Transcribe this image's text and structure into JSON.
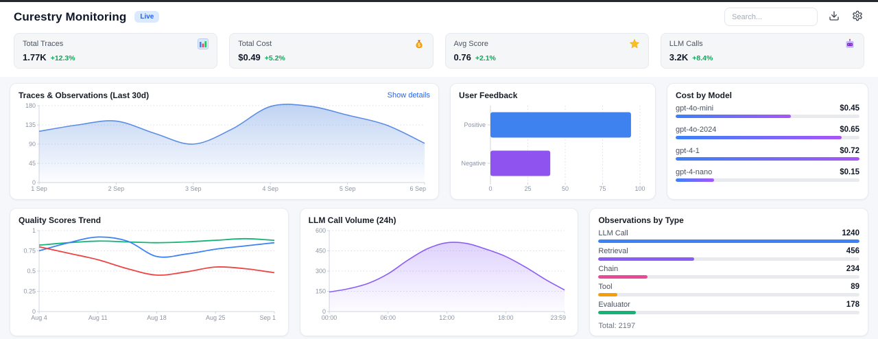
{
  "header": {
    "title": "Curestry Monitoring",
    "live_badge": "Live",
    "search_placeholder": "Search..."
  },
  "stats": [
    {
      "label": "Total Traces",
      "value": "1.77K",
      "delta": "+12.3%",
      "icon": "bar-chart"
    },
    {
      "label": "Total Cost",
      "value": "$0.49",
      "delta": "+5.2%",
      "icon": "money-bag"
    },
    {
      "label": "Avg Score",
      "value": "0.76",
      "delta": "+2.1%",
      "icon": "star"
    },
    {
      "label": "LLM Calls",
      "value": "3.2K",
      "delta": "+8.4%",
      "icon": "robot"
    }
  ],
  "panels": {
    "traces": {
      "title": "Traces & Observations (Last 30d)",
      "link": "Show details"
    },
    "feedback": {
      "title": "User Feedback"
    },
    "cost": {
      "title": "Cost by Model"
    },
    "quality": {
      "title": "Quality Scores Trend"
    },
    "volume": {
      "title": "LLM Call Volume (24h)"
    },
    "observations": {
      "title": "Observations by Type",
      "total": "Total: 2197"
    }
  },
  "chart_data": [
    {
      "id": "traces",
      "type": "area",
      "title": "Traces & Observations (Last 30d)",
      "x_ticks": [
        "1 Sep",
        "2 Sep",
        "3 Sep",
        "4 Sep",
        "5 Sep",
        "6 Sep"
      ],
      "y_ticks": [
        "0",
        "45",
        "90",
        "135",
        "180"
      ],
      "ylim": [
        0,
        180
      ],
      "values": [
        120,
        135,
        144,
        115,
        90,
        125,
        178,
        179,
        158,
        135,
        92
      ],
      "line_color": "#5b8de4",
      "fill_from": "rgba(130,167,230,0.50)",
      "fill_to": "rgba(130,167,230,0.02)"
    },
    {
      "id": "feedback",
      "type": "bar",
      "orientation": "horizontal",
      "title": "User Feedback",
      "categories": [
        "Positive",
        "Negative"
      ],
      "values": [
        94,
        40
      ],
      "bar_colors": [
        "#3d82ee",
        "#8f53f0"
      ],
      "x_ticks": [
        "0",
        "25",
        "50",
        "75",
        "100"
      ],
      "xlim": [
        0,
        100
      ]
    },
    {
      "id": "cost",
      "type": "table",
      "title": "Cost by Model",
      "rows": [
        {
          "label": "gpt-4o-mini",
          "value": "$0.45",
          "fraction": 0.625
        },
        {
          "label": "gpt-4o-2024",
          "value": "$0.65",
          "fraction": 0.903
        },
        {
          "label": "gpt-4-1",
          "value": "$0.72",
          "fraction": 1.0
        },
        {
          "label": "gpt-4-nano",
          "value": "$0.15",
          "fraction": 0.208
        }
      ],
      "bar_gradient": [
        "#3b82f6",
        "#a855f7"
      ]
    },
    {
      "id": "quality",
      "type": "line",
      "title": "Quality Scores Trend",
      "x_ticks": [
        "Aug 4",
        "Aug 11",
        "Aug 18",
        "Aug 25",
        "Sep 1"
      ],
      "y_ticks": [
        "0",
        "0.25",
        "0.5",
        "0.75",
        "1"
      ],
      "ylim": [
        0,
        1
      ],
      "series": [
        {
          "name": "series-green",
          "color": "#14b376",
          "values": [
            0.82,
            0.85,
            0.87,
            0.86,
            0.85,
            0.86,
            0.88,
            0.9,
            0.88
          ]
        },
        {
          "name": "series-blue",
          "color": "#3b82f6",
          "values": [
            0.75,
            0.85,
            0.92,
            0.87,
            0.68,
            0.71,
            0.77,
            0.81,
            0.85
          ]
        },
        {
          "name": "series-red",
          "color": "#ef4444",
          "values": [
            0.8,
            0.72,
            0.64,
            0.53,
            0.45,
            0.49,
            0.55,
            0.53,
            0.48
          ]
        }
      ]
    },
    {
      "id": "volume",
      "type": "area",
      "title": "LLM Call Volume (24h)",
      "x_ticks": [
        "00:00",
        "06:00",
        "12:00",
        "18:00",
        "23:59"
      ],
      "y_ticks": [
        "0",
        "150",
        "300",
        "450",
        "600"
      ],
      "ylim": [
        0,
        600
      ],
      "values": [
        145,
        170,
        210,
        280,
        380,
        465,
        510,
        505,
        462,
        408,
        330,
        240,
        160
      ],
      "line_color": "#8b5cf6",
      "fill_from": "rgba(139,92,246,0.28)",
      "fill_to": "rgba(139,92,246,0.02)"
    },
    {
      "id": "observations",
      "type": "table",
      "title": "Observations by Type",
      "rows": [
        {
          "label": "LLM Call",
          "value": "1240",
          "color": "#3b82f6",
          "fraction": 1.0
        },
        {
          "label": "Retrieval",
          "value": "456",
          "color": "#8b5cf6",
          "fraction": 0.368
        },
        {
          "label": "Chain",
          "value": "234",
          "color": "#ec4899",
          "fraction": 0.189
        },
        {
          "label": "Tool",
          "value": "89",
          "color": "#f59e0b",
          "fraction": 0.072
        },
        {
          "label": "Evaluator",
          "value": "178",
          "color": "#14b376",
          "fraction": 0.144
        }
      ],
      "total": "Total: 2197"
    }
  ],
  "colors": {
    "accent_blue": "#2563eb",
    "positive_green": "#17a35b",
    "grid": "#d8dde5",
    "axis": "#cfd5de",
    "tick_text": "#8b94a4"
  }
}
